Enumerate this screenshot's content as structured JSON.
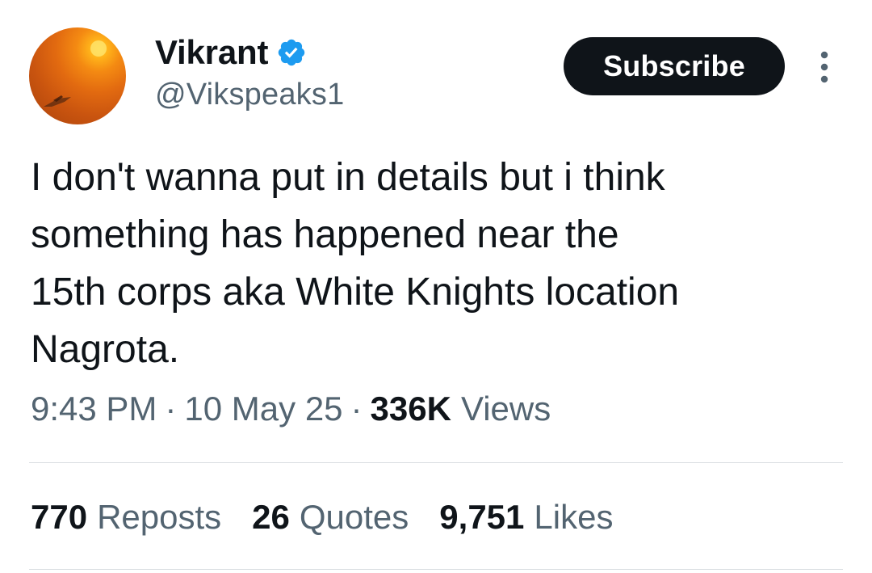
{
  "user": {
    "display_name": "Vikrant",
    "handle": "@Vikspeaks1",
    "verified": true
  },
  "actions": {
    "subscribe_label": "Subscribe",
    "more_icon": "more-vertical-icon"
  },
  "tweet": {
    "text": "I don't wanna put in details but i think\nsomething has happened near the\n15th corps aka White Knights location\nNagrota."
  },
  "meta": {
    "time": "9:43 PM",
    "date": "10 May 25",
    "separator": "·",
    "views_count": "336K",
    "views_label": "Views"
  },
  "stats": {
    "reposts": {
      "count": "770",
      "label": "Reposts"
    },
    "quotes": {
      "count": "26",
      "label": "Quotes"
    },
    "likes": {
      "count": "9,751",
      "label": "Likes"
    }
  },
  "colors": {
    "text_primary": "#0f1419",
    "text_secondary": "#536471",
    "verified_blue": "#1d9bf0",
    "subscribe_bg": "#0f1419",
    "divider": "#d9dde1"
  }
}
